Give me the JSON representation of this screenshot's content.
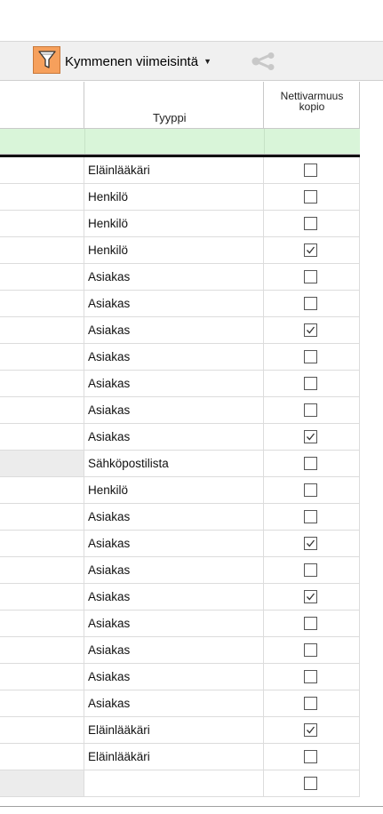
{
  "toolbar": {
    "view_label": "Kymmenen viimeisintä",
    "filter_icon": "funnel-icon",
    "share_icon": "share-icon",
    "accent": "#f6a05c"
  },
  "grid": {
    "columns": [
      {
        "label": ""
      },
      {
        "label": "Tyyppi"
      },
      {
        "label_line1": "Nettivarmuus",
        "label_line2": "kopio"
      }
    ],
    "filter_row_color": "#d9f5d9",
    "rows": [
      {
        "type": "Eläinlääkäri",
        "backup": false
      },
      {
        "type": "Henkilö",
        "backup": false
      },
      {
        "type": "Henkilö",
        "backup": false
      },
      {
        "type": "Henkilö",
        "backup": true
      },
      {
        "type": "Asiakas",
        "backup": false
      },
      {
        "type": "Asiakas",
        "backup": false
      },
      {
        "type": "Asiakas",
        "backup": true
      },
      {
        "type": "Asiakas",
        "backup": false
      },
      {
        "type": "Asiakas",
        "backup": false
      },
      {
        "type": "Asiakas",
        "backup": false
      },
      {
        "type": "Asiakas",
        "backup": true
      },
      {
        "type": "Sähköpostilista",
        "backup": false,
        "grey": true
      },
      {
        "type": "Henkilö",
        "backup": false
      },
      {
        "type": "Asiakas",
        "backup": false
      },
      {
        "type": "Asiakas",
        "backup": true
      },
      {
        "type": "Asiakas",
        "backup": false
      },
      {
        "type": "Asiakas",
        "backup": true
      },
      {
        "type": "Asiakas",
        "backup": false
      },
      {
        "type": "Asiakas",
        "backup": false
      },
      {
        "type": "Asiakas",
        "backup": false
      },
      {
        "type": "Asiakas",
        "backup": false
      },
      {
        "type": "Eläinlääkäri",
        "backup": true
      },
      {
        "type": "Eläinlääkäri",
        "backup": false
      },
      {
        "type": "",
        "backup": false,
        "grey": true
      }
    ]
  }
}
